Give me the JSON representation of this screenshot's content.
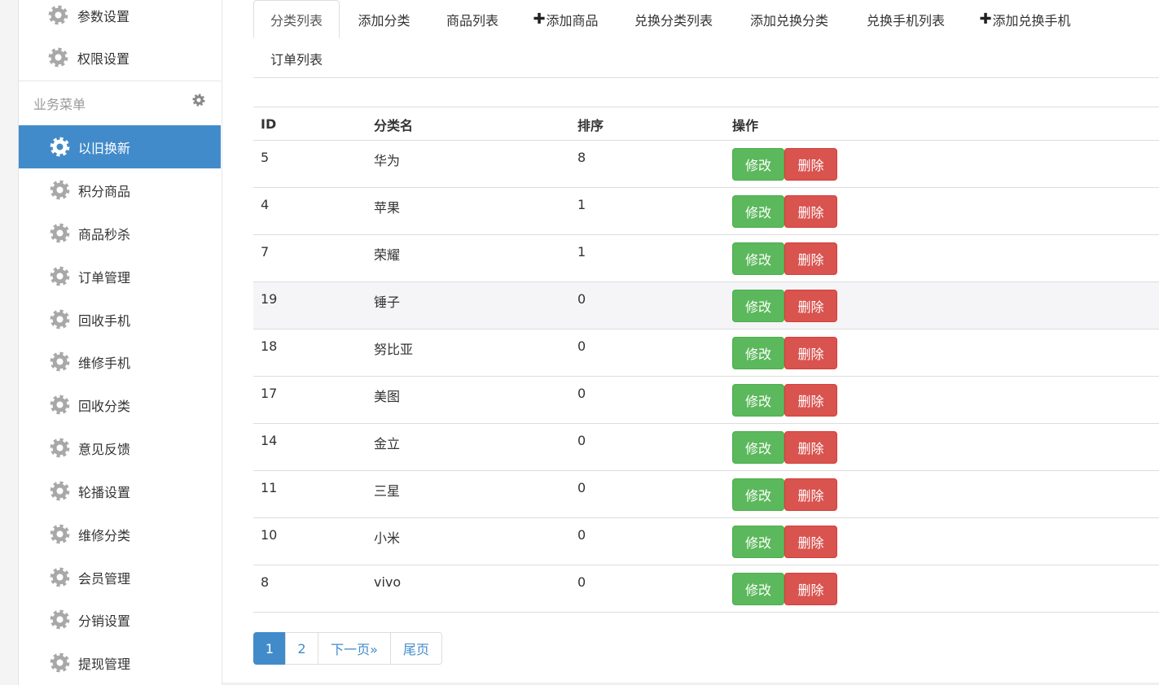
{
  "sidebar": {
    "top_items": [
      {
        "label": "参数设置",
        "icon": "gear-icon"
      },
      {
        "label": "权限设置",
        "icon": "gear-icon"
      }
    ],
    "section": {
      "label": "业务菜单",
      "icon": "gear-icon"
    },
    "items": [
      {
        "label": "以旧换新",
        "icon": "gear-icon",
        "active": true
      },
      {
        "label": "积分商品",
        "icon": "gear-icon"
      },
      {
        "label": "商品秒杀",
        "icon": "gear-icon"
      },
      {
        "label": "订单管理",
        "icon": "gear-icon"
      },
      {
        "label": "回收手机",
        "icon": "gear-icon"
      },
      {
        "label": "维修手机",
        "icon": "gear-icon"
      },
      {
        "label": "回收分类",
        "icon": "gear-icon"
      },
      {
        "label": "意见反馈",
        "icon": "gear-icon"
      },
      {
        "label": "轮播设置",
        "icon": "gear-icon"
      },
      {
        "label": "维修分类",
        "icon": "gear-icon"
      },
      {
        "label": "会员管理",
        "icon": "gear-icon"
      },
      {
        "label": "分销设置",
        "icon": "gear-icon"
      },
      {
        "label": "提现管理",
        "icon": "gear-icon"
      }
    ]
  },
  "tabs": [
    {
      "label": "分类列表",
      "active": true
    },
    {
      "label": "添加分类"
    },
    {
      "label": "商品列表"
    },
    {
      "label": "添加商品",
      "plus": "✚"
    },
    {
      "label": "兑换分类列表"
    },
    {
      "label": "添加兑换分类"
    },
    {
      "label": "兑换手机列表"
    },
    {
      "label": "添加兑换手机",
      "plus": "✚"
    },
    {
      "label": "订单列表"
    }
  ],
  "table": {
    "headers": {
      "id": "ID",
      "name": "分类名",
      "sort": "排序",
      "ops": "操作"
    },
    "edit_label": "修改",
    "delete_label": "删除",
    "rows": [
      {
        "id": "5",
        "name": "华为",
        "sort": "8"
      },
      {
        "id": "4",
        "name": "苹果",
        "sort": "1"
      },
      {
        "id": "7",
        "name": "荣耀",
        "sort": "1"
      },
      {
        "id": "19",
        "name": "锤子",
        "sort": "0"
      },
      {
        "id": "18",
        "name": "努比亚",
        "sort": "0"
      },
      {
        "id": "17",
        "name": "美图",
        "sort": "0"
      },
      {
        "id": "14",
        "name": "金立",
        "sort": "0"
      },
      {
        "id": "11",
        "name": "三星",
        "sort": "0"
      },
      {
        "id": "10",
        "name": "小米",
        "sort": "0"
      },
      {
        "id": "8",
        "name": "vivo",
        "sort": "0"
      }
    ]
  },
  "pagination": {
    "pages": [
      "1",
      "2"
    ],
    "current": "1",
    "next_label": "下一页»",
    "last_label": "尾页"
  },
  "colors": {
    "primary": "#428bca",
    "success": "#5cb85c",
    "danger": "#d9534f"
  }
}
